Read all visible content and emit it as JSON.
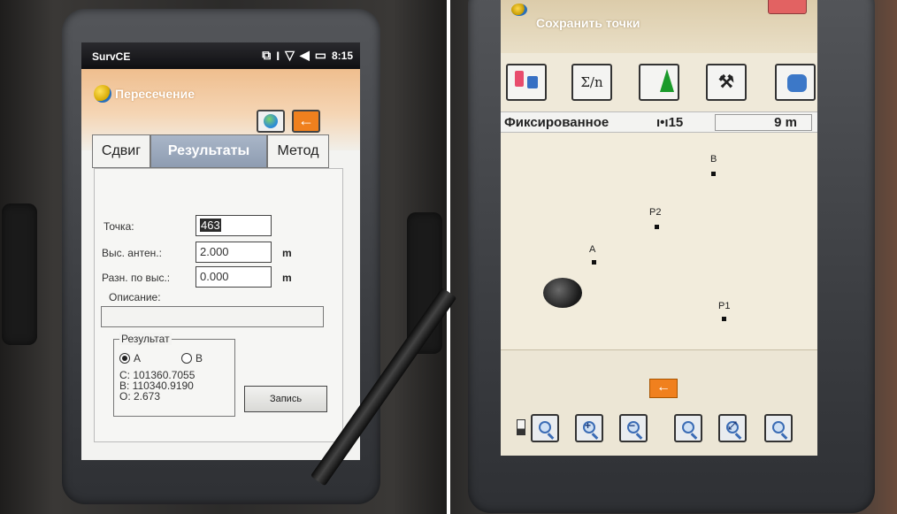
{
  "left_screen": {
    "status_bar": {
      "app_name": "SurvCE",
      "time": "8:15"
    },
    "title": "Пересечение",
    "tabs": [
      "Сдвиг",
      "Результаты",
      "Метод"
    ],
    "form": {
      "point_label": "Точка:",
      "point_value": "463",
      "antenna_height_label": "Выс. антен.:",
      "antenna_height_value": "2.000",
      "height_diff_label": "Разн. по выс.:",
      "height_diff_value": "0.000",
      "unit": "m",
      "description_label": "Описание:",
      "description_value": ""
    },
    "result_group": {
      "title": "Результат",
      "option_a": "A",
      "option_b": "B",
      "selected": "A",
      "c_line": "C: 101360.7055",
      "b_line": "B: 110340.9190",
      "o_line": "O: 2.673"
    },
    "save_button": "Запись"
  },
  "right_screen": {
    "title": "Сохранить точки",
    "toolbar": {
      "sum_label": "Σ/n",
      "tools_label": "⚒"
    },
    "info_bar": {
      "fix_status": "Фиксированное",
      "satellites": "15",
      "scale": "9 m"
    },
    "map_points": [
      "B",
      "P2",
      "A",
      "P1"
    ],
    "zoom_symbols": [
      "+",
      "−",
      "⤢"
    ],
    "colors": {
      "back_button": "#f0801e",
      "title_bg": "#dcccaa"
    }
  }
}
